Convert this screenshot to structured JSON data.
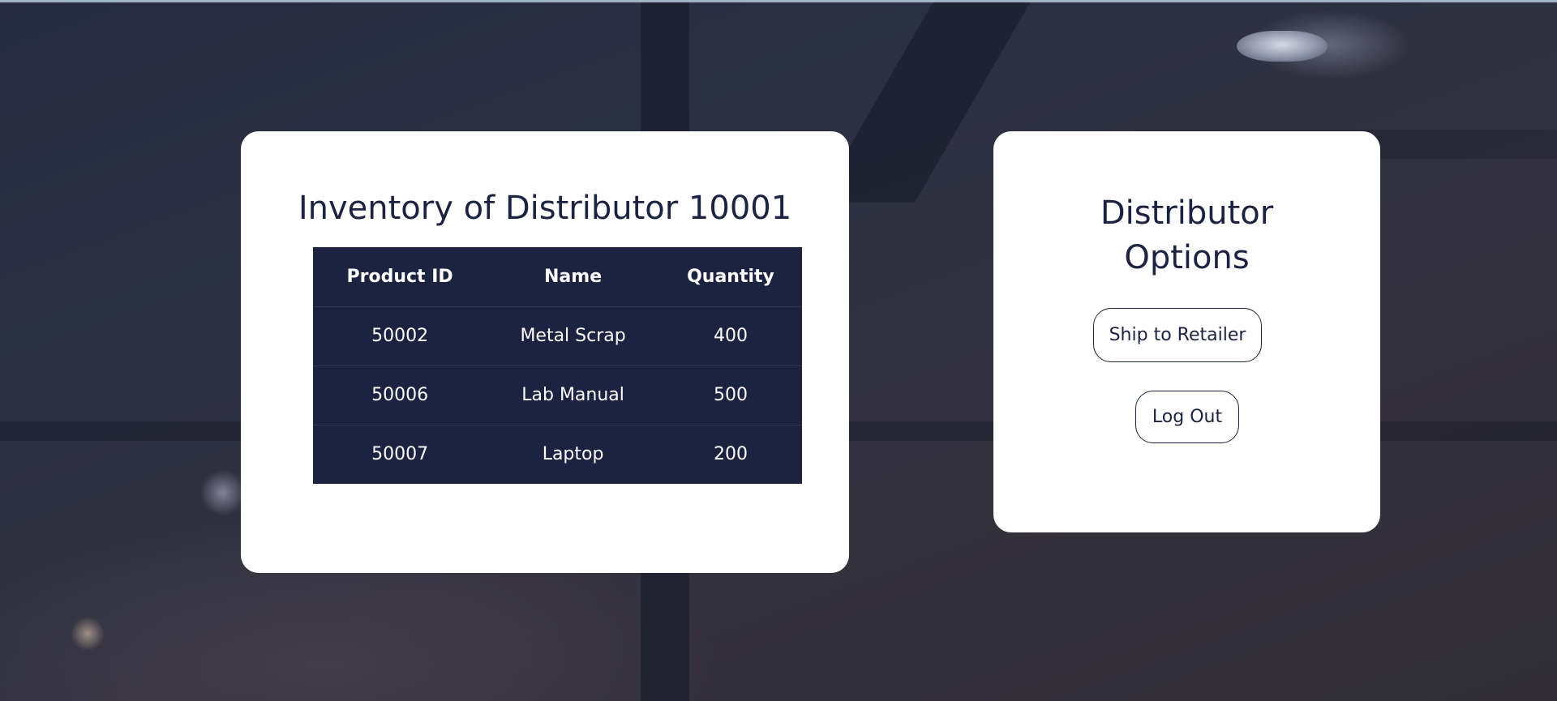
{
  "inventory": {
    "title": "Inventory of Distributor 10001",
    "columns": [
      "Product ID",
      "Name",
      "Quantity"
    ],
    "rows": [
      [
        "50002",
        "Metal Scrap",
        "400"
      ],
      [
        "50006",
        "Lab Manual",
        "500"
      ],
      [
        "50007",
        "Laptop",
        "200"
      ]
    ]
  },
  "options": {
    "title_line1": "Distributor",
    "title_line2": "Options",
    "ship_label": "Ship to Retailer",
    "logout_label": "Log Out"
  },
  "colors": {
    "primary": "#1c2340",
    "card": "#ffffff"
  }
}
